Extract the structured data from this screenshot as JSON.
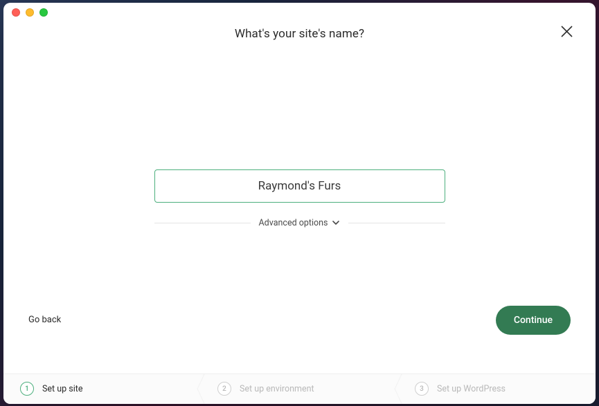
{
  "header": {
    "title": "What's your site's name?"
  },
  "form": {
    "site_name_value": "Raymond's Furs",
    "advanced_label": "Advanced options"
  },
  "actions": {
    "back_label": "Go back",
    "continue_label": "Continue"
  },
  "steps": [
    {
      "number": "1",
      "label": "Set up site",
      "state": "active"
    },
    {
      "number": "2",
      "label": "Set up environment",
      "state": "inactive"
    },
    {
      "number": "3",
      "label": "Set up WordPress",
      "state": "inactive"
    }
  ],
  "colors": {
    "accent": "#4caf7d",
    "primary_button": "#337b53"
  }
}
